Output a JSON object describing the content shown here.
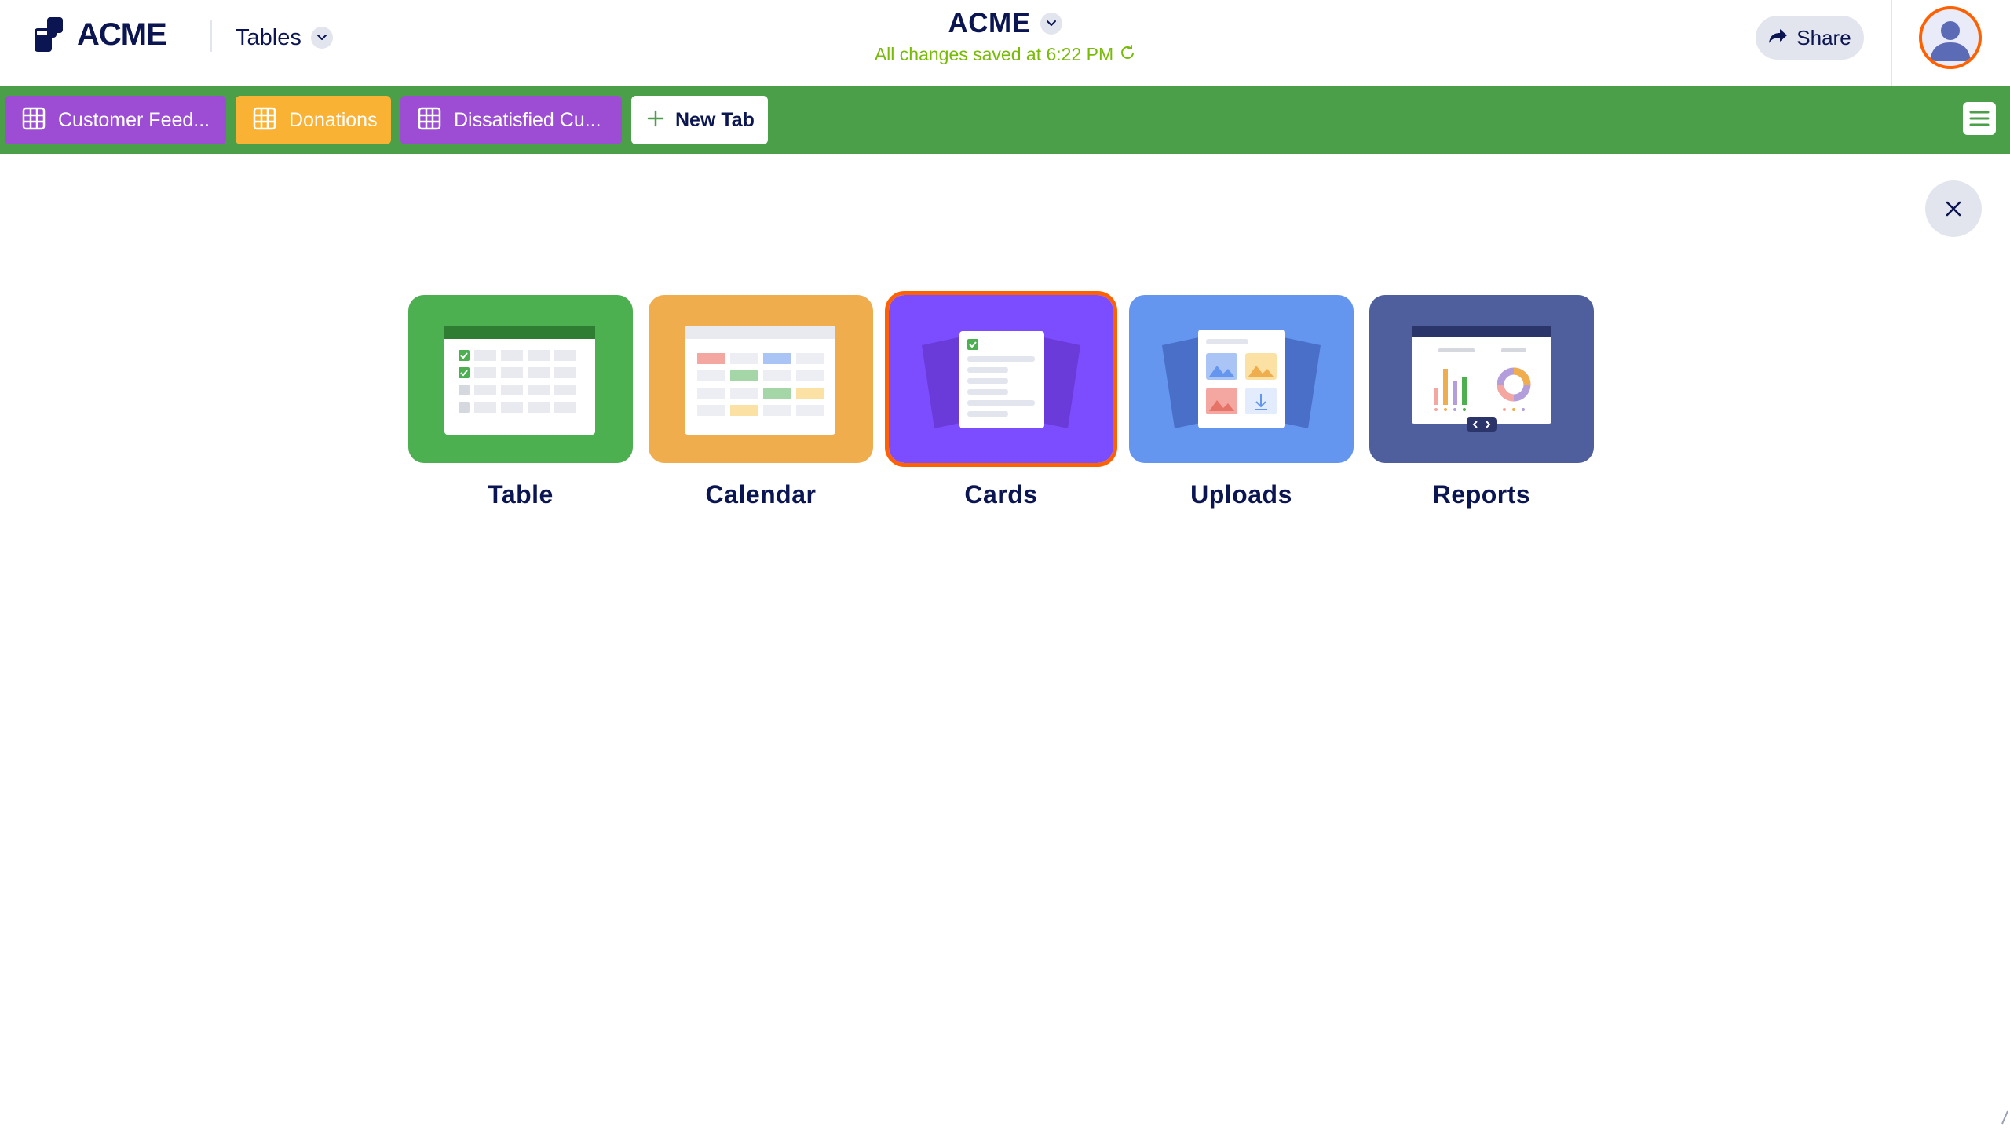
{
  "header": {
    "logo_text": "ACME",
    "product_label": "Tables",
    "doc_title": "ACME",
    "save_status": "All changes saved at 6:22 PM",
    "share_label": "Share",
    "colors": {
      "navy": "#0a1551",
      "status_green": "#78bb07",
      "avatar_ring": "#ff6100"
    }
  },
  "tabs": [
    {
      "label": "Customer Feed...",
      "color": "#9c4dd3",
      "icon": "table-grid-icon"
    },
    {
      "label": "Donations",
      "color": "#f9b234",
      "icon": "table-grid-icon"
    },
    {
      "label": "Dissatisfied Cu...",
      "color": "#9c4dd3",
      "icon": "table-grid-icon"
    }
  ],
  "new_tab_label": "New Tab",
  "tabbar_color": "#4a9f48",
  "views": [
    {
      "label": "Table",
      "color": "#4caf50",
      "selected": false
    },
    {
      "label": "Calendar",
      "color": "#f0ad4e",
      "selected": false
    },
    {
      "label": "Cards",
      "color": "#7c4dff",
      "selected": true
    },
    {
      "label": "Uploads",
      "color": "#6496ef",
      "selected": false
    },
    {
      "label": "Reports",
      "color": "#4f5f9e",
      "selected": false
    }
  ],
  "selection_color": "#ff6100"
}
